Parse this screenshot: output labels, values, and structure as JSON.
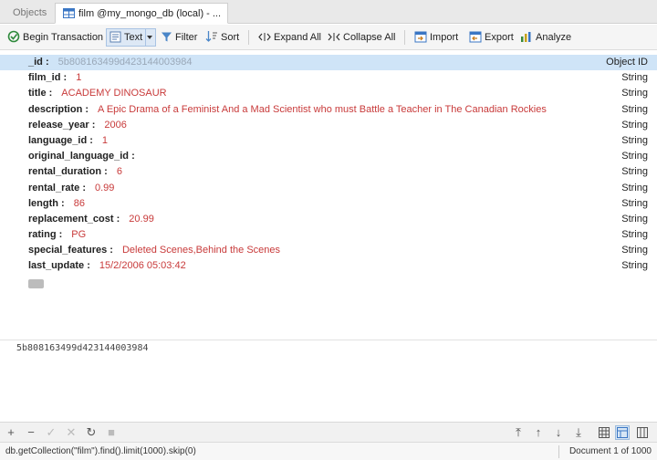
{
  "tabs": [
    {
      "label": "Objects"
    },
    {
      "label": "film @my_mongo_db (local) - ..."
    }
  ],
  "toolbar": {
    "begin_transaction": "Begin Transaction",
    "text": "Text",
    "filter": "Filter",
    "sort": "Sort",
    "expand_all": "Expand All",
    "collapse_all": "Collapse All",
    "import": "Import",
    "export": "Export",
    "analyze": "Analyze"
  },
  "document": {
    "fields": [
      {
        "key": "_id",
        "value": "5b808163499d423144003984",
        "type": "Object ID"
      },
      {
        "key": "film_id",
        "value": "1",
        "type": "String"
      },
      {
        "key": "title",
        "value": "ACADEMY DINOSAUR",
        "type": "String"
      },
      {
        "key": "description",
        "value": "A Epic Drama of a Feminist And a Mad Scientist who must Battle a Teacher in The Canadian Rockies",
        "type": "String"
      },
      {
        "key": "release_year",
        "value": "2006",
        "type": "String"
      },
      {
        "key": "language_id",
        "value": "1",
        "type": "String"
      },
      {
        "key": "original_language_id",
        "value": "",
        "type": "String"
      },
      {
        "key": "rental_duration",
        "value": "6",
        "type": "String"
      },
      {
        "key": "rental_rate",
        "value": "0.99",
        "type": "String"
      },
      {
        "key": "length",
        "value": "86",
        "type": "String"
      },
      {
        "key": "replacement_cost",
        "value": "20.99",
        "type": "String"
      },
      {
        "key": "rating",
        "value": "PG",
        "type": "String"
      },
      {
        "key": "special_features",
        "value": "Deleted Scenes,Behind the Scenes",
        "type": "String"
      },
      {
        "key": "last_update",
        "value": "15/2/2006 05:03:42",
        "type": "String"
      }
    ],
    "key_separator": " :"
  },
  "detail_panel": {
    "object_id": "5b808163499d423144003984"
  },
  "status": {
    "query": "db.getCollection(\"film\").find().limit(1000).skip(0)",
    "position": "Document 1 of 1000"
  },
  "colors": {
    "selected_row": "#cfe4f7",
    "value_text": "#c83a3a",
    "toolbar_bg": "#f5f5f5"
  }
}
